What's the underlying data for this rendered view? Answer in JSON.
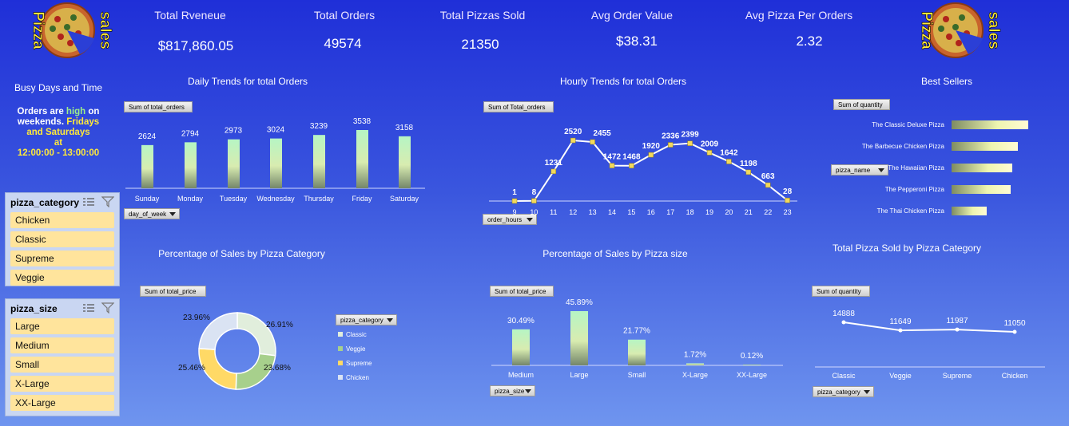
{
  "kpis": [
    {
      "label": "Total Rveneue",
      "value": "$817,860.05"
    },
    {
      "label": "Total Orders",
      "value": "49574"
    },
    {
      "label": "Total Pizzas Sold",
      "value": "21350"
    },
    {
      "label": "Avg Order Value",
      "value": "$38.31"
    },
    {
      "label": "Avg Pizza Per Orders",
      "value": "2.32"
    }
  ],
  "logo": {
    "word1": "Pizza",
    "word2": "sales"
  },
  "busy": {
    "heading": "Busy Days and Time",
    "l1a": "Orders are ",
    "l1b": "high",
    "l1c": " on",
    "l2a": "weekends. ",
    "l2b": "Fridays",
    "l3": "and Saturdays",
    "l4": "at",
    "l5": "12:00:00 - 13:00:00"
  },
  "slicers": {
    "category": {
      "title": "pizza_category",
      "items": [
        "Chicken",
        "Classic",
        "Supreme",
        "Veggie"
      ]
    },
    "size": {
      "title": "pizza_size",
      "items": [
        "Large",
        "Medium",
        "Small",
        "X-Large",
        "XX-Large"
      ]
    }
  },
  "colors": {
    "bar_top": "#b4f2c4",
    "bar_bottom": "#7c8a6e",
    "line": "#ffffff",
    "marker": "#f2d95c",
    "classic": "#e1eedc",
    "veggie": "#a7d08c",
    "supreme": "#ffd966",
    "chicken": "#dae3f3"
  },
  "charts": {
    "daily": {
      "title": "Daily Trends for total Orders",
      "value_btn": "Sum of total_orders",
      "axis_btn": "day_of_week"
    },
    "hourly": {
      "title": "Hourly Trends for total Orders",
      "value_btn": "Sum of Total_orders",
      "axis_btn": "order_hours"
    },
    "best": {
      "title": "Best Sellers",
      "value_btn": "Sum of quantity",
      "axis_btn": "pizza_name"
    },
    "category_pct": {
      "title": "Percentage of Sales by Pizza Category",
      "value_btn": "Sum of total_price",
      "axis_btn": "pizza_category"
    },
    "size_pct": {
      "title": "Percentage of Sales by Pizza size",
      "value_btn": "Sum of total_price",
      "axis_btn": "pizza_size"
    },
    "cat_sold": {
      "title": "Total Pizza Sold by Pizza Category",
      "value_btn": "Sum of quantity",
      "axis_btn": "pizza_category"
    }
  },
  "chart_data": [
    {
      "id": "daily",
      "type": "bar",
      "title": "Daily Trends for total Orders",
      "categories": [
        "Sunday",
        "Monday",
        "Tuesday",
        "Wednesday",
        "Thursday",
        "Friday",
        "Saturday"
      ],
      "values": [
        2624,
        2794,
        2973,
        3024,
        3239,
        3538,
        3158
      ]
    },
    {
      "id": "hourly",
      "type": "line",
      "title": "Hourly Trends for total Orders",
      "x": [
        "9",
        "10",
        "11",
        "12",
        "13",
        "14",
        "15",
        "16",
        "17",
        "18",
        "19",
        "20",
        "21",
        "22",
        "23"
      ],
      "values": [
        1,
        8,
        1231,
        2520,
        2455,
        1472,
        1468,
        1920,
        2336,
        2399,
        2009,
        1642,
        1198,
        663,
        28
      ]
    },
    {
      "id": "best",
      "type": "bar",
      "title": "Best Sellers",
      "orientation": "horizontal",
      "categories": [
        "The Classic Deluxe Pizza",
        "The Barbecue Chicken Pizza",
        "The Hawaiian Pizza",
        "The Pepperoni Pizza",
        "The Thai Chicken Pizza"
      ],
      "values": [
        2453,
        2432,
        2422,
        2418,
        2371
      ]
    },
    {
      "id": "category_pct",
      "type": "pie",
      "title": "Percentage of Sales by Pizza Category",
      "categories": [
        "Classic",
        "Veggie",
        "Supreme",
        "Chicken"
      ],
      "values": [
        26.91,
        23.68,
        25.46,
        23.96
      ],
      "labels": [
        "26.91%",
        "23.68%",
        "25.46%",
        "23.96%"
      ]
    },
    {
      "id": "size_pct",
      "type": "bar",
      "title": "Percentage of Sales by Pizza size",
      "categories": [
        "Medium",
        "Large",
        "Small",
        "X-Large",
        "XX-Large"
      ],
      "values": [
        30.49,
        45.89,
        21.77,
        1.72,
        0.12
      ],
      "labels": [
        "30.49%",
        "45.89%",
        "21.77%",
        "1.72%",
        "0.12%"
      ]
    },
    {
      "id": "cat_sold",
      "type": "line",
      "title": "Total Pizza Sold by Pizza Category",
      "categories": [
        "Classic",
        "Veggie",
        "Supreme",
        "Chicken"
      ],
      "values": [
        14888,
        11649,
        11987,
        11050
      ]
    }
  ]
}
